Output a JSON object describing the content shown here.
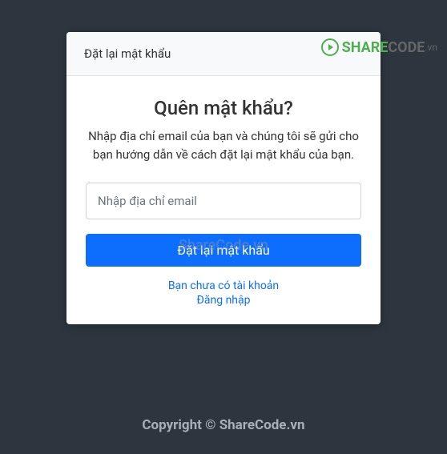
{
  "logo": {
    "share": "SHARE",
    "code": "CODE",
    "vn": ".vn"
  },
  "card": {
    "header": "Đặt lại mật khẩu",
    "title": "Quên mật khẩu?",
    "description": "Nhập địa chỉ email của bạn và chúng tôi sẽ gửi cho bạn hướng dẫn về cách đặt lại mật khẩu của bạn.",
    "email_placeholder": "Nhập địa chỉ email",
    "submit_label": "Đặt lại mật khẩu",
    "register_link": "Bạn chưa có tài khoản",
    "login_link": "Đăng nhập"
  },
  "watermark": "ShareCode.vn",
  "footer": {
    "prefix": "Copyright © ",
    "link": "ShareCode.vn"
  }
}
